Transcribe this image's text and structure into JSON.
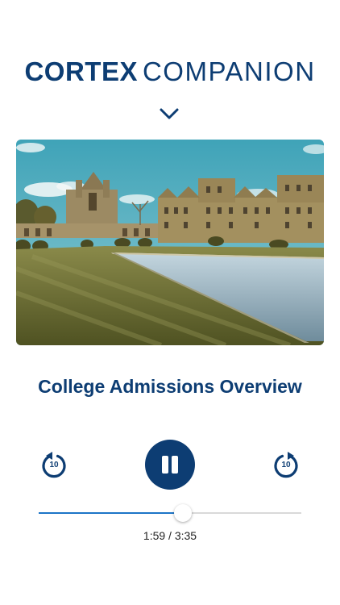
{
  "brand": {
    "bold": "CORTEX",
    "light": "COMPANION"
  },
  "header": {
    "collapse_icon": "chevron-down-icon"
  },
  "artwork": {
    "subject": "college campus with Gothic stone buildings, lawn and reflecting pool"
  },
  "track": {
    "title": "College Admissions Overview"
  },
  "controls": {
    "skip_back": {
      "icon": "rewind-10-icon",
      "label": "10"
    },
    "play_pause": {
      "icon": "pause-icon",
      "state": "playing"
    },
    "skip_forward": {
      "icon": "forward-10-icon",
      "label": "10"
    }
  },
  "playback": {
    "elapsed": "1:59",
    "separator": " / ",
    "duration": "3:35",
    "time_display": "1:59 / 3:35",
    "progress_fraction": 0.55
  },
  "colors": {
    "brand_blue": "#0d3d73",
    "progress_blue": "#1c74c7",
    "rail_gray": "#d9d9d9"
  }
}
